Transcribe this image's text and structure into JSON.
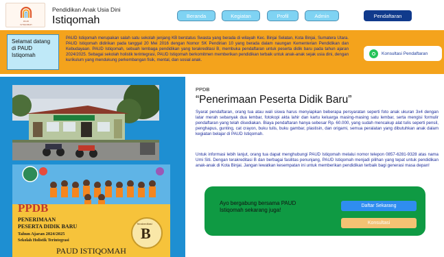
{
  "header": {
    "logo_line1": "PAUD",
    "logo_line2": "ISTIQOMAH",
    "subtitle": "Pendidikan Anak Usia Dini",
    "name": "Istiqomah",
    "nav": [
      {
        "label": "Beranda"
      },
      {
        "label": "Kegiatan"
      },
      {
        "label": "Profil"
      },
      {
        "label": "Admin"
      }
    ],
    "cta_label": "Pendaftaran"
  },
  "strip": {
    "welcome": "Selamat datang di PAUD Istiqomah",
    "description": "PAUD Istiqomah merupakan salah satu sekolah jenjang KB berstatus Swasta yang berada di wilayah Kec. Binjai Selatan, Kota Binjai, Sumatera Utara. PAUD Istiqomah didirikan pada tanggal 20 Mei 2016 dengan Nomor SK Pendirian 10 yang berada dalam naungan Kementerian Pendidikan dan Kebudayaan. PAUD Istiqomah, sebuah lembaga pendidikan yang terakreditasi B, membuka pendaftaran untuk peserta didik baru pada tahun ajaran 2024/2025. Sebagai sekolah holistik terintegrasi, PAUD Istiqomah berkomitmen memberikan pendidikan terbaik untuk anak-anak sejak usia dini, dengan kurikulum yang mendukung perkembangan fisik, mental, dan sosial anak.",
    "whatsapp_label": "Konsultasi Pendaftaran"
  },
  "poster": {
    "ppdb": "PPDB",
    "line1": "PENERIMAAN",
    "line2": "PESERTA DIDIK BARU",
    "year": "Tahun Ajaran 2024/2025",
    "school_type": "Sekolah Holistik Terintegrasi",
    "badge_caption": "Terakreditasi",
    "grade": "B",
    "footer": "PAUD ISTIQOMAH"
  },
  "content": {
    "small_heading": "PPDB",
    "title": "“Penerimaan Peserta Didik Baru”",
    "para1": "Syarat pendaftaran, orang tua atau wali siswa harus menyiapkan beberapa persyaratan seperti foto anak ukuran 3x4 dengan latar merah sebanyak dua lembar, fotokopi akta lahir dan kartu keluarga masing-masing satu lembar, serta mengisi formulir pendaftaran yang telah disediakan. Biaya pendaftaran hanya sebesar Rp. 60.000, yang sudah mencakup alat tulis seperti pensil, penghapus, gunting, cat crayon, buku tulis, buku gambar, plastisin, dan origami, semua peralatan yang dibutuhkan anak dalam kegiatan belajar di PAUD Istiqomah.",
    "para2": "Untuk informasi lebih lanjut, orang tua dapat menghubungi PAUD Istiqomah melalui nomor telepon 0857-6281-9328 atas nama Umi Siti. Dengan terakreditasi B dan berbagai fasilitas penunjang, PAUD Istiqomah menjadi pilihan yang tepat untuk pendidikan anak-anak di Kota Binjai. Jangan lewatkan kesempatan ini untuk memberikan pendidikan terbaik bagi generasi masa depan!",
    "cta_text": "Ayo bergabung bersama PAUD Istiqomah sekarang juga!",
    "btn_register": "Daftar Sekarang",
    "btn_consult": "Konsultasi"
  }
}
